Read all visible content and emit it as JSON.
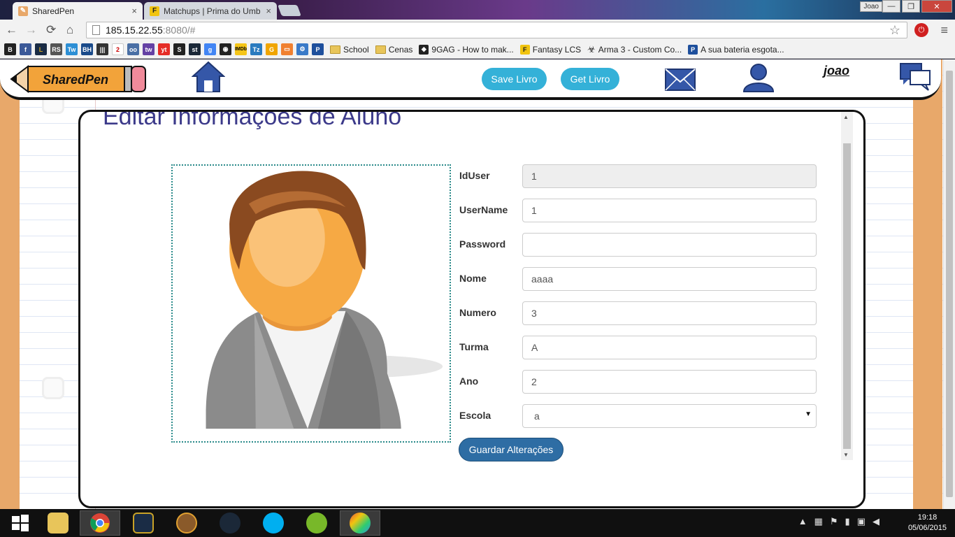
{
  "browser": {
    "tabs": [
      {
        "title": "SharedPen",
        "close": "×",
        "active": true
      },
      {
        "title": "Matchups | Prima do Umb",
        "close": "×",
        "active": false
      }
    ],
    "profile_name": "Joao",
    "window_controls": {
      "minimize": "—",
      "maximize": "❐",
      "close": "✕"
    },
    "url_host": "185.15.22.55",
    "url_path": ":8080/#",
    "nav": {
      "back": "←",
      "forward": "→",
      "reload": "⟳",
      "home": "⌂"
    },
    "star": "☆",
    "menu": "≡",
    "bookmarks": {
      "icons": [
        "B",
        "f",
        "L",
        "RS",
        "Tw",
        "BH",
        "|||",
        "2",
        "oo",
        "tw",
        "yt",
        "S",
        "st",
        "g",
        "◉",
        "IMDb",
        "Tz",
        "G",
        "▭",
        "⚙",
        "P"
      ],
      "items": [
        {
          "label": "School",
          "icon": "folder"
        },
        {
          "label": "Cenas",
          "icon": "folder"
        },
        {
          "label": "9GAG - How to mak...",
          "icon": "9gag-icon"
        },
        {
          "label": "Fantasy LCS",
          "icon": "fantasy-icon"
        },
        {
          "label": "Arma 3 - Custom Co...",
          "icon": "biohazard-icon"
        },
        {
          "label": "A sua bateria esgota...",
          "icon": "p-icon"
        }
      ]
    }
  },
  "app": {
    "logo_text": "SharedPen",
    "header_buttons": {
      "save_livro": "Save Livro",
      "get_livro": "Get Livro"
    },
    "username": "joao",
    "page_title": "Editar Informações de Aluno",
    "form": {
      "fields": [
        {
          "label": "IdUser",
          "value": "1",
          "disabled": true
        },
        {
          "label": "UserName",
          "value": "1",
          "disabled": false
        },
        {
          "label": "Password",
          "value": "",
          "disabled": false
        },
        {
          "label": "Nome",
          "value": "aaaa",
          "disabled": false
        },
        {
          "label": "Numero",
          "value": "3",
          "disabled": false
        },
        {
          "label": "Turma",
          "value": "A",
          "disabled": false
        },
        {
          "label": "Ano",
          "value": "2",
          "disabled": false
        }
      ],
      "escola_label": "Escola",
      "escola_selected": "a",
      "submit_label": "Guardar Alterações"
    }
  },
  "taskbar": {
    "time": "19:18",
    "date": "05/06/2015",
    "tray_chevron": "▲"
  },
  "colors": {
    "accent": "#34b1d8",
    "title": "#3c3a8a",
    "primary": "#2e6da4",
    "orange": "#e8a86a"
  }
}
